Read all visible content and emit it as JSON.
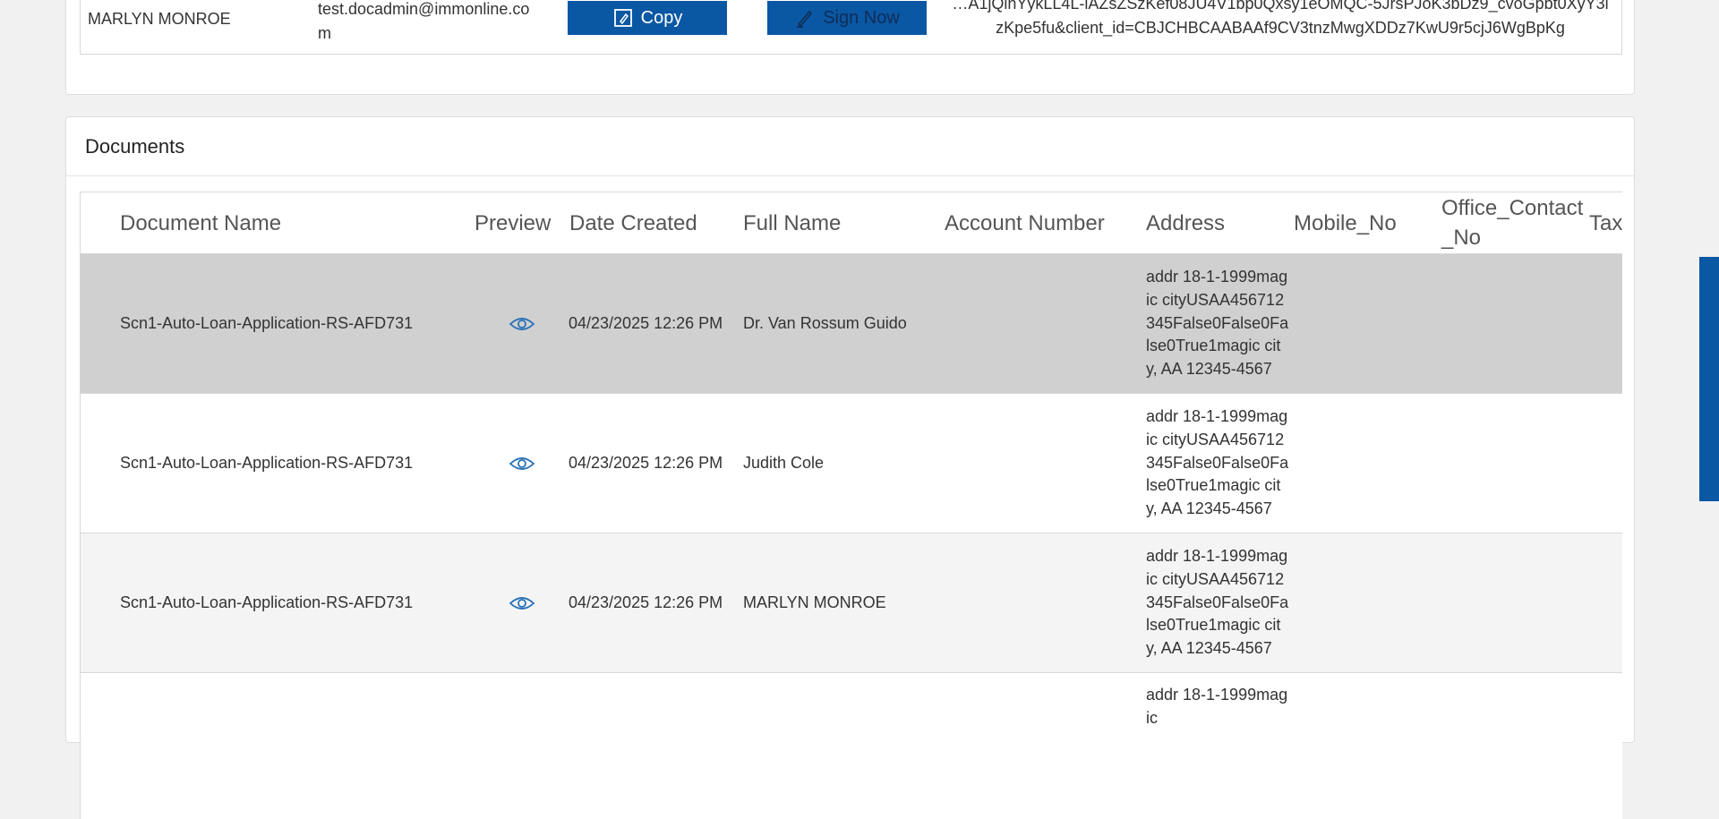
{
  "signer": {
    "name": "MARLYN MONROE",
    "email": "test.docadmin@immonline.com",
    "copy_label": "Copy",
    "sign_label": "Sign Now",
    "link_text": "…A1jQinYykLL4L-lAZsZSzKef08JU4V1bp0Qxsy1eOMQC-5JrsPJoK3bDz9_cvoGpbt0XyY3izKpe5fu&client_id=CBJCHBCAABAAf9CV3tnzMwgXDDz7KwU9r5cjJ6WgBpKg"
  },
  "documents": {
    "title": "Documents",
    "columns": [
      "Document Name",
      "Preview",
      "Date Created",
      "Full Name",
      "Account Number",
      "Address",
      "Mobile_No",
      "Office_Contact_No",
      "Tax"
    ],
    "rows": [
      {
        "doc_name": "Scn1-Auto-Loan-Application-RS-AFD731",
        "date": "04/23/2025 12:26 PM",
        "full_name": "Dr. Van Rossum Guido",
        "account": "",
        "address": "addr 18-1-1999magic cityUSAA456712345False0False0False0True1magic city, AA 12345-4567",
        "mobile": "",
        "office": "",
        "tax": "",
        "state": "selected"
      },
      {
        "doc_name": "Scn1-Auto-Loan-Application-RS-AFD731",
        "date": "04/23/2025 12:26 PM",
        "full_name": "Judith Cole",
        "account": "",
        "address": "addr 18-1-1999magic cityUSAA456712345False0False0False0True1magic city, AA 12345-4567",
        "mobile": "",
        "office": "",
        "tax": "",
        "state": "plain"
      },
      {
        "doc_name": "Scn1-Auto-Loan-Application-RS-AFD731",
        "date": "04/23/2025 12:26 PM",
        "full_name": "MARLYN MONROE",
        "account": "",
        "address": "addr 18-1-1999magic cityUSAA456712345False0False0False0True1magic city, AA 12345-4567",
        "mobile": "",
        "office": "",
        "tax": "",
        "state": "alt"
      },
      {
        "doc_name": "",
        "date": "",
        "full_name": "",
        "account": "",
        "address": "addr 18-1-1999magic",
        "mobile": "",
        "office": "",
        "tax": "",
        "state": "plain"
      }
    ]
  },
  "colors": {
    "accent": "#0a57a4",
    "selected_row": "#d0d0d0",
    "alt_row": "#f4f4f4"
  },
  "icons": {
    "copy": "copy-icon",
    "sign": "pen-icon",
    "preview": "eye-icon"
  }
}
